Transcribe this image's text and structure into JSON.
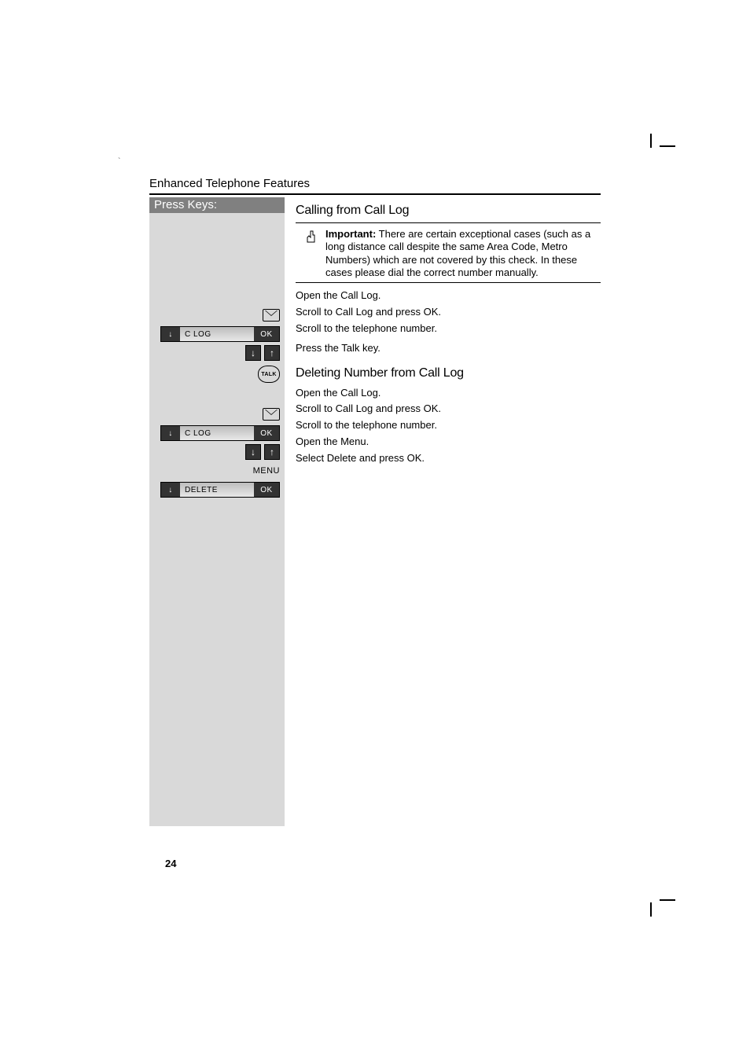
{
  "header": {
    "section_title": "Enhanced Telephone Features",
    "press_keys_label": "Press Keys:"
  },
  "heading_calling": "Calling from Call Log",
  "important": {
    "label": "Important:",
    "text": " There are certain exceptional cases (such as a long distance call despite the same Area Code, Metro Numbers) which are not covered by this check. In these cases please dial the correct number manually."
  },
  "calling_steps": {
    "s1_key_name": "envelope-key",
    "s1_text": "Open the Call Log.",
    "s2_lcd_mid": "C LOG",
    "s2_lcd_right": "OK",
    "s2_text": "Scroll to Call Log and press OK.",
    "s3_text": "Scroll to the telephone number.",
    "s4_key_label": "TALK",
    "s4_text": "Press the Talk key."
  },
  "heading_deleting": "Deleting Number from Call Log",
  "deleting_steps": {
    "s1_text": "Open the Call Log.",
    "s2_lcd_mid": "C LOG",
    "s2_lcd_right": "OK",
    "s2_text": "Scroll to Call Log and press OK.",
    "s3_text": "Scroll to the telephone number.",
    "s4_label": "MENU",
    "s4_text": "Open the Menu.",
    "s5_lcd_mid": "DELETE",
    "s5_lcd_right": "OK",
    "s5_text": "Select Delete and press OK."
  },
  "page_number": "24",
  "glyphs": {
    "down_arrow": "↓",
    "up_arrow": "↑"
  }
}
